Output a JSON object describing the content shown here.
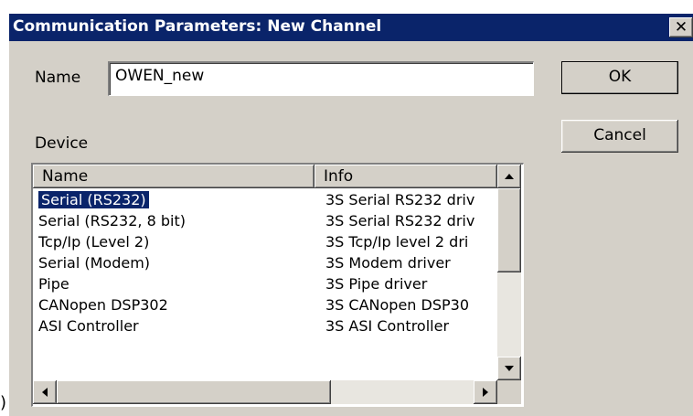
{
  "dialog": {
    "title": "Communication Parameters: New Channel",
    "close_glyph": "✕"
  },
  "name_field": {
    "label": "Name",
    "value": "OWEN_new"
  },
  "buttons": {
    "ok": "OK",
    "cancel": "Cancel"
  },
  "device": {
    "label": "Device",
    "columns": [
      "Name",
      "Info"
    ],
    "rows": [
      {
        "name": "Serial (RS232)",
        "info": "3S Serial RS232 driv",
        "selected": true
      },
      {
        "name": "Serial (RS232, 8 bit)",
        "info": "3S Serial RS232 driv"
      },
      {
        "name": "Tcp/Ip (Level 2)",
        "info": "3S Tcp/Ip level 2 dri"
      },
      {
        "name": "Serial (Modem)",
        "info": "3S Modem driver"
      },
      {
        "name": "Pipe",
        "info": "3S Pipe driver"
      },
      {
        "name": "CANopen DSP302",
        "info": "3S CANopen DSP30"
      },
      {
        "name": "ASI Controller",
        "info": "3S ASI Controller"
      }
    ],
    "icons": {
      "scroll_up": "up-arrow-icon",
      "scroll_down": "down-arrow-icon",
      "scroll_left": "left-arrow-icon",
      "scroll_right": "right-arrow-icon"
    }
  },
  "edge_glyph": ")",
  "colors": {
    "face": "#d4d0c8",
    "titlebar": "#0a246a",
    "selection": "#0a246a"
  }
}
